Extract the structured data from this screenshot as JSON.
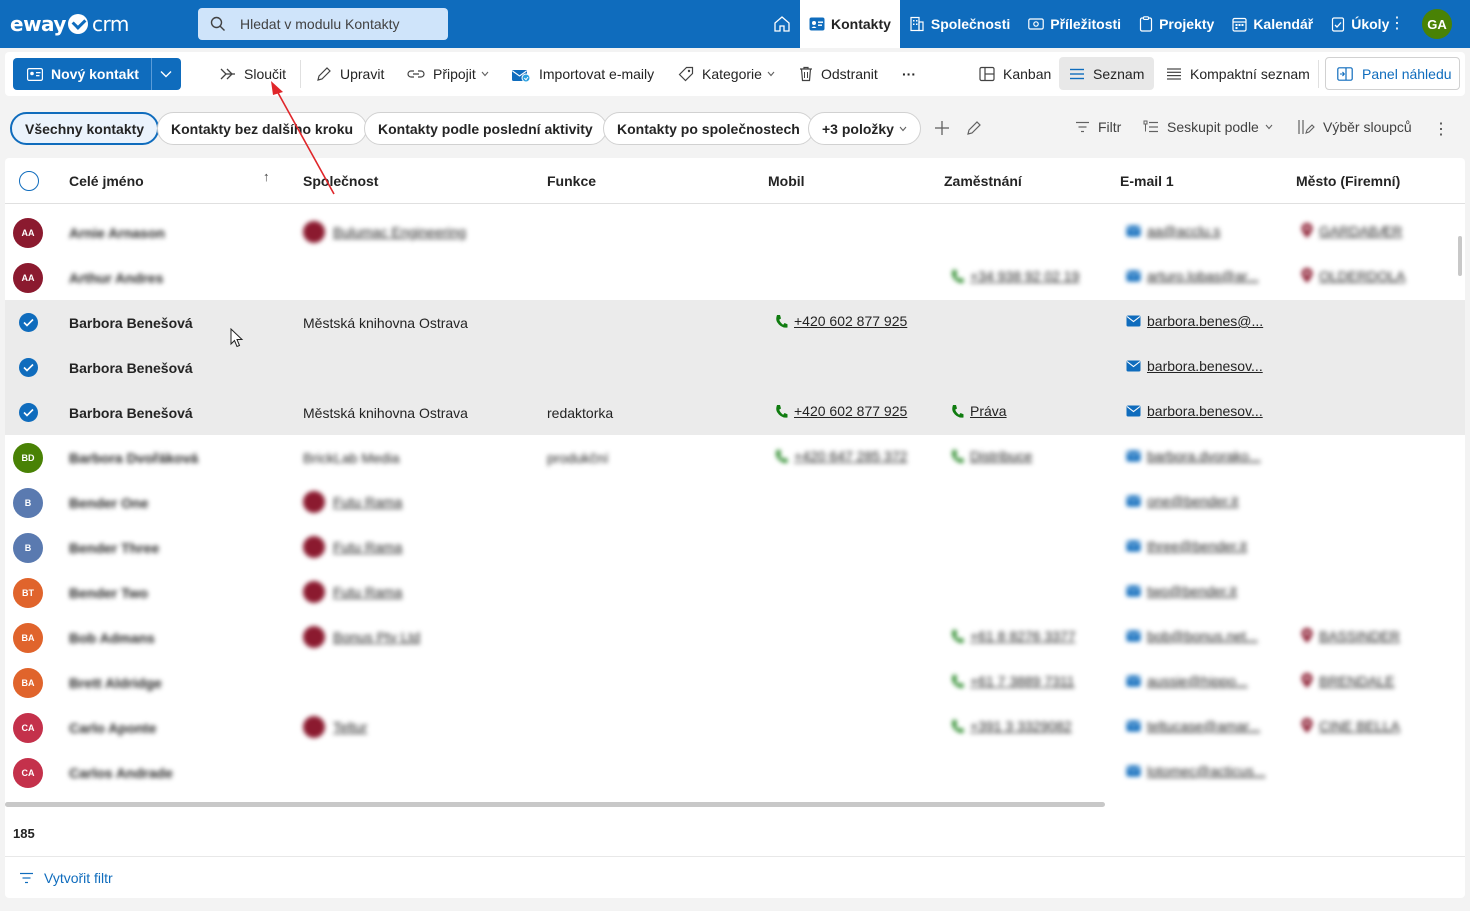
{
  "app": {
    "logo_left": "eway",
    "logo_right": "crm"
  },
  "search": {
    "placeholder": "Hledat v modulu Kontakty"
  },
  "nav": {
    "items": [
      {
        "label": "Kontakty",
        "icon": "contact-card-icon",
        "active": true
      },
      {
        "label": "Společnosti",
        "icon": "building-icon"
      },
      {
        "label": "Příležitosti",
        "icon": "money-icon"
      },
      {
        "label": "Projekty",
        "icon": "clipboard-icon"
      },
      {
        "label": "Kalendář",
        "icon": "calendar-icon"
      },
      {
        "label": "Úkoly",
        "icon": "task-icon"
      }
    ],
    "user_initials": "GA"
  },
  "toolbar": {
    "new_contact": "Nový kontakt",
    "merge": "Sloučit",
    "edit": "Upravit",
    "attach": "Připojit",
    "import_emails": "Importovat e-maily",
    "category": "Kategorie",
    "delete": "Odstranit",
    "more": "···",
    "kanban": "Kanban",
    "list": "Seznam",
    "compact_list": "Kompaktní seznam",
    "preview_panel": "Panel náhledu"
  },
  "filters": {
    "pills": [
      "Všechny kontakty",
      "Kontakty bez dalšího kroku",
      "Kontakty podle poslední aktivity",
      "Kontakty po společnostech",
      "+3 položky"
    ],
    "filter": "Filtr",
    "group_by": "Seskupit podle",
    "columns": "Výběr sloupců"
  },
  "grid": {
    "columns": [
      "Celé jméno",
      "Společnost",
      "Funkce",
      "Mobil",
      "Zaměstnání",
      "E-mail 1",
      "Město (Firemní)"
    ],
    "sort_indicator": "↑",
    "rows": [
      {
        "name": "Arnie Arnason",
        "initials": "AA",
        "avatar_color": "#8b1a2f",
        "company": "Bulumac Engineering",
        "company_dot": true,
        "function": "",
        "mobile": "",
        "job": "",
        "email": "aa@acclu.s",
        "city": "GARDABÆR",
        "blurred": true
      },
      {
        "name": "Arthur Andres",
        "initials": "AA",
        "avatar_color": "#8b1a2f",
        "company": "",
        "company_dot": false,
        "function": "",
        "mobile": "",
        "job": "+34 938 92 02 19",
        "email": "arturo.lobas@ar...",
        "city": "OLDERDOLA",
        "blurred": true
      },
      {
        "name": "Barbora Benešová",
        "selected": true,
        "company": "Městská knihovna Ostrava",
        "company_dot": false,
        "function": "",
        "mobile": "+420 602 877 925",
        "job": "",
        "email": "barbora.benes@...",
        "city": "",
        "blurred": false
      },
      {
        "name": "Barbora Benešová",
        "selected": true,
        "company": "",
        "company_dot": false,
        "function": "",
        "mobile": "",
        "job": "",
        "email": "barbora.benesov...",
        "city": "",
        "blurred": false
      },
      {
        "name": "Barbora Benešová",
        "selected": true,
        "company": "Městská knihovna Ostrava",
        "company_dot": false,
        "function": "redaktorka",
        "mobile": "+420 602 877 925",
        "job": "Práva",
        "email": "barbora.benesov...",
        "city": "",
        "blurred": false
      },
      {
        "name": "Barbora Dvořáková",
        "initials": "BD",
        "avatar_color": "#498205",
        "company": "BrickLab Media",
        "company_dot": false,
        "function": "produkční",
        "mobile": "+420 647 285 372",
        "job": "Distribuce",
        "email": "barbora.dvorako...",
        "city": "",
        "blurred": true
      },
      {
        "name": "Bender One",
        "initials": "B",
        "avatar_color": "#5a7ab0",
        "company": "Futu Rama",
        "company_dot": true,
        "function": "",
        "mobile": "",
        "job": "",
        "email": "one@bender.it",
        "city": "",
        "blurred": true
      },
      {
        "name": "Bender Three",
        "initials": "B",
        "avatar_color": "#5a7ab0",
        "company": "Futu Rama",
        "company_dot": true,
        "function": "",
        "mobile": "",
        "job": "",
        "email": "three@bender.it",
        "city": "",
        "blurred": true
      },
      {
        "name": "Bender Two",
        "initials": "BT",
        "avatar_color": "#e0642c",
        "company": "Futu Rama",
        "company_dot": true,
        "function": "",
        "mobile": "",
        "job": "",
        "email": "two@bender.it",
        "city": "",
        "blurred": true
      },
      {
        "name": "Bob Admans",
        "initials": "BA",
        "avatar_color": "#e0642c",
        "company": "Bonus Pty Ltd",
        "company_dot": true,
        "function": "",
        "mobile": "",
        "job": "+61 8 8276 3377",
        "email": "bob@bonus.net...",
        "city": "BASSINDER",
        "blurred": true
      },
      {
        "name": "Brett Aldridge",
        "initials": "BA",
        "avatar_color": "#e0642c",
        "company": "",
        "company_dot": false,
        "function": "",
        "mobile": "",
        "job": "+61 7 3889 7311",
        "email": "aussie@hippo...",
        "city": "BRENDALE",
        "blurred": true
      },
      {
        "name": "Carlo Aponte",
        "initials": "CA",
        "avatar_color": "#c4314b",
        "company": "Teltur",
        "company_dot": true,
        "function": "",
        "mobile": "",
        "job": "+391 3 3329082",
        "email": "teltucase@amar...",
        "city": "CINE BELLA",
        "blurred": true
      },
      {
        "name": "Carlos Andrade",
        "initials": "CA",
        "avatar_color": "#c4314b",
        "company": "",
        "company_dot": false,
        "function": "",
        "mobile": "",
        "job": "",
        "email": "lotomec@acticus...",
        "city": "",
        "blurred": true
      }
    ],
    "record_count": "185"
  },
  "footer": {
    "create_filter": "Vytvořit filtr"
  },
  "colors": {
    "brand": "#0f6cbd",
    "phone_green": "#107c10",
    "selected_row": "#ebebeb"
  }
}
